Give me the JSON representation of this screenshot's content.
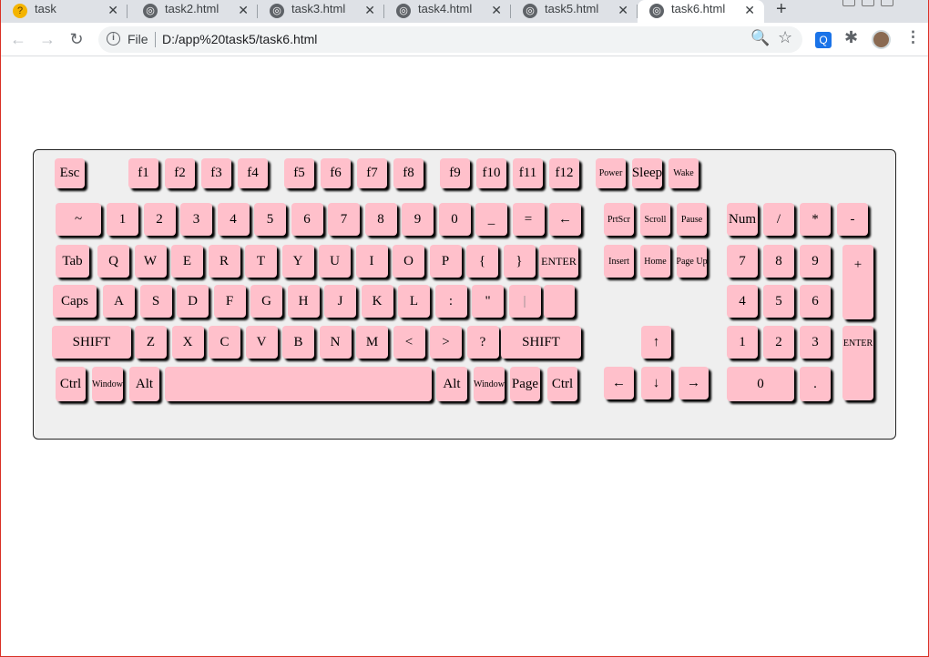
{
  "browser": {
    "tabs": [
      {
        "label": "task",
        "icon": "custom-favicon-icon"
      },
      {
        "label": "task2.html",
        "icon": "globe-icon"
      },
      {
        "label": "task3.html",
        "icon": "globe-icon"
      },
      {
        "label": "task4.html",
        "icon": "globe-icon"
      },
      {
        "label": "task5.html",
        "icon": "globe-icon"
      },
      {
        "label": "task6.html",
        "icon": "globe-icon",
        "active": true
      }
    ],
    "close_glyph": "✕",
    "new_tab_glyph": "+",
    "nav": {
      "back": "←",
      "forward": "→",
      "reload": "↻"
    },
    "address": {
      "scheme_label": "File",
      "url": "D:/app%20task5/task6.html",
      "info_glyph": "i"
    },
    "icons": {
      "zoom": "🔍",
      "star": "☆",
      "ext": "Q",
      "puzzle": "✱",
      "menu": "⋮"
    }
  },
  "keyboard": {
    "function_row": [
      "Esc",
      "f1",
      "f2",
      "f3",
      "f4",
      "f5",
      "f6",
      "f7",
      "f8",
      "f9",
      "f10",
      "f11",
      "f12"
    ],
    "power_keys": [
      "Power",
      "Sleep",
      "Wake"
    ],
    "number_row": [
      "~",
      "1",
      "2",
      "3",
      "4",
      "5",
      "6",
      "7",
      "8",
      "9",
      "0",
      "_",
      "=",
      "←"
    ],
    "qwerty_row": [
      "Tab",
      "Q",
      "W",
      "E",
      "R",
      "T",
      "Y",
      "U",
      "I",
      "O",
      "P",
      "{",
      "}",
      "ENTER"
    ],
    "home_row": [
      "Caps",
      "A",
      "S",
      "D",
      "F",
      "G",
      "H",
      "J",
      "K",
      "L",
      ":",
      "\"",
      "|",
      ""
    ],
    "shift_row": [
      "SHIFT",
      "Z",
      "X",
      "C",
      "V",
      "B",
      "N",
      "M",
      "<",
      ">",
      "?",
      "SHIFT"
    ],
    "bottom_row": [
      "Ctrl",
      "Window",
      "Alt",
      "",
      "Alt",
      "Window",
      "Page",
      "Ctrl"
    ],
    "nav_cluster": [
      "PrtScr",
      "Scroll",
      "Pause",
      "Insert",
      "Home",
      "Page Up"
    ],
    "arrows": {
      "up": "↑",
      "left": "←",
      "down": "↓",
      "right": "→"
    },
    "numpad": [
      "Num",
      "/",
      "*",
      "-",
      "7",
      "8",
      "9",
      "+",
      "4",
      "5",
      "6",
      "1",
      "2",
      "3",
      "ENTER",
      "0",
      "."
    ]
  }
}
